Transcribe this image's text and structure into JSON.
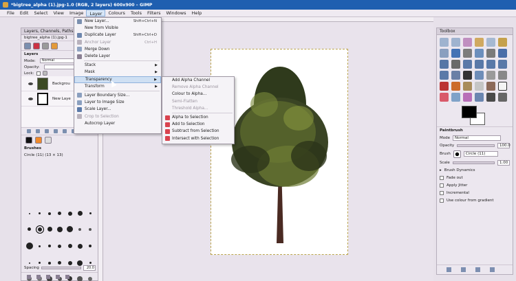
{
  "window": {
    "title": "*bigtree_alpha (1).jpg-1.0 (RGB, 2 layers) 600x900 – GIMP"
  },
  "menubar": [
    "File",
    "Edit",
    "Select",
    "View",
    "Image",
    "Layer",
    "Colours",
    "Tools",
    "Filters",
    "Windows",
    "Help"
  ],
  "layer_menu": {
    "items": [
      {
        "label": "New Layer...",
        "shortcut": "Shift+Ctrl+N",
        "disabled": false,
        "submenu": false
      },
      {
        "label": "New from Visible",
        "shortcut": "",
        "disabled": false,
        "submenu": false
      },
      {
        "label": "Duplicate Layer",
        "shortcut": "Shift+Ctrl+D",
        "disabled": false,
        "submenu": false
      },
      {
        "label": "Anchor Layer",
        "shortcut": "Ctrl+H",
        "disabled": true,
        "submenu": false
      },
      {
        "label": "Merge Down",
        "shortcut": "",
        "disabled": false,
        "submenu": false
      },
      {
        "label": "Delete Layer",
        "shortcut": "",
        "disabled": false,
        "submenu": false
      },
      {
        "sep": true
      },
      {
        "label": "Stack",
        "shortcut": "",
        "disabled": false,
        "submenu": true
      },
      {
        "label": "Mask",
        "shortcut": "",
        "disabled": false,
        "submenu": true
      },
      {
        "label": "Transparency",
        "shortcut": "",
        "disabled": false,
        "submenu": true,
        "highlighted": true
      },
      {
        "label": "Transform",
        "shortcut": "",
        "disabled": false,
        "submenu": true
      },
      {
        "sep": true
      },
      {
        "label": "Layer Boundary Size...",
        "shortcut": "",
        "disabled": false,
        "submenu": false
      },
      {
        "label": "Layer to Image Size",
        "shortcut": "",
        "disabled": false,
        "submenu": false
      },
      {
        "label": "Scale Layer...",
        "shortcut": "",
        "disabled": false,
        "submenu": false
      },
      {
        "label": "Crop to Selection",
        "shortcut": "",
        "disabled": true,
        "submenu": false
      },
      {
        "label": "Autocrop Layer",
        "shortcut": "",
        "disabled": false,
        "submenu": false
      }
    ]
  },
  "transparency_submenu": {
    "items": [
      {
        "label": "Add Alpha Channel",
        "disabled": false
      },
      {
        "label": "Remove Alpha Channel",
        "disabled": true
      },
      {
        "label": "Colour to Alpha...",
        "disabled": false
      },
      {
        "label": "Semi-Flatten",
        "disabled": true
      },
      {
        "label": "Threshold Alpha...",
        "disabled": true
      },
      {
        "sep": true
      },
      {
        "label": "Alpha to Selection",
        "disabled": false
      },
      {
        "label": "Add to Selection",
        "disabled": false
      },
      {
        "label": "Subtract from Selection",
        "disabled": false
      },
      {
        "label": "Intersect with Selection",
        "disabled": false
      }
    ]
  },
  "layers_dock": {
    "title": "Layers, Channels, Paths, Un",
    "image_selector": "bigtree_alpha (1).jpg-1",
    "section": "Layers",
    "mode_label": "Mode:",
    "mode_value": "Normal",
    "opacity_label": "Opacity:",
    "lock_label": "Lock:",
    "layers": [
      {
        "name": "Backgrou"
      },
      {
        "name": "New Laye"
      }
    ],
    "brushes": {
      "title": "Brushes",
      "current": "Circle (11) (13 × 13)",
      "spacing_label": "Spacing",
      "spacing_value": "20.0"
    }
  },
  "toolbox": {
    "title": "Toolbox",
    "fg_color": "#000000",
    "bg_color": "#ffffff",
    "tool_options": {
      "title": "Paintbrush",
      "mode_label": "Mode",
      "mode_value": "Normal",
      "opacity_label": "Opacity",
      "opacity_value": "100.0",
      "brush_label": "Brush",
      "brush_value": "Circle (11)",
      "scale_label": "Scale",
      "scale_value": "1.00",
      "brush_dynamics": "Brush Dynamics",
      "fade_out": "Fade out",
      "apply_jitter": "Apply Jitter",
      "incremental": "Incremental",
      "use_gradient": "Use colour from gradient"
    }
  }
}
